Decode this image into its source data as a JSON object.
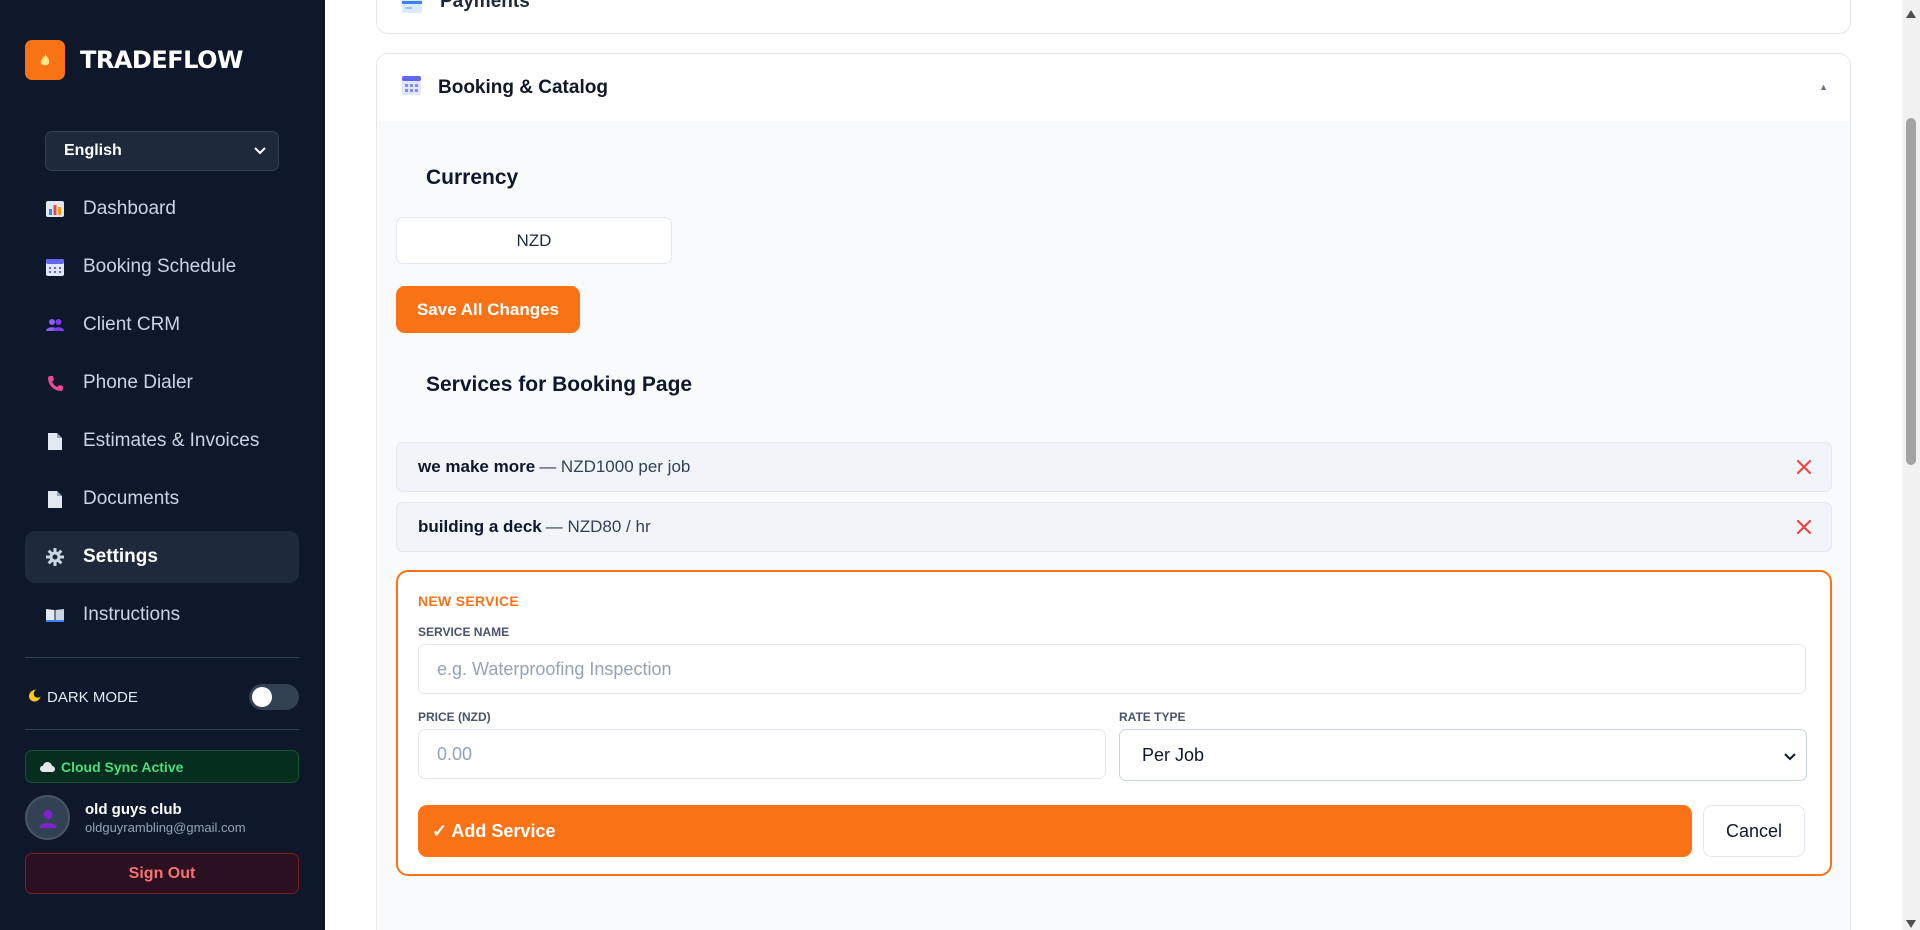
{
  "app": {
    "brand": "TRADEFLOW",
    "brand_icon": "flame-icon",
    "accent_color": "#f97316",
    "sidebar_bg": "#0f172a"
  },
  "sidebar": {
    "language": "English",
    "items": [
      {
        "label": "Dashboard",
        "icon": "bar-chart-icon",
        "active": false
      },
      {
        "label": "Booking Schedule",
        "icon": "calendar-icon",
        "active": false
      },
      {
        "label": "Client CRM",
        "icon": "users-icon",
        "active": false
      },
      {
        "label": "Phone Dialer",
        "icon": "phone-icon",
        "active": false
      },
      {
        "label": "Estimates & Invoices",
        "icon": "document-icon",
        "active": false
      },
      {
        "label": "Documents",
        "icon": "document-icon",
        "active": false
      },
      {
        "label": "Settings",
        "icon": "gear-icon",
        "active": true
      },
      {
        "label": "Instructions",
        "icon": "book-icon",
        "active": false
      }
    ],
    "dark_mode_label": "DARK MODE",
    "dark_mode_on": false,
    "sync_status": "Cloud Sync Active",
    "user": {
      "name": "old guys club",
      "email": "oldguyrambling@gmail.com"
    },
    "sign_out_label": "Sign Out"
  },
  "main": {
    "payments_section_title": "Payments",
    "booking_section": {
      "title": "Booking & Catalog",
      "expanded": true,
      "currency_heading": "Currency",
      "currency_value": "NZD",
      "save_label": "Save All Changes",
      "services_heading": "Services for Booking Page",
      "services": [
        {
          "name": "we make more",
          "detail": "— NZD1000 per job"
        },
        {
          "name": "building a deck",
          "detail": "— NZD80 / hr"
        }
      ],
      "new_service": {
        "title": "NEW SERVICE",
        "name_label": "SERVICE NAME",
        "name_placeholder": "e.g. Waterproofing Inspection",
        "price_label": "PRICE (NZD)",
        "price_placeholder": "0.00",
        "rate_label": "RATE TYPE",
        "rate_value": "Per Job",
        "add_label": "✓ Add Service",
        "cancel_label": "Cancel"
      }
    }
  }
}
